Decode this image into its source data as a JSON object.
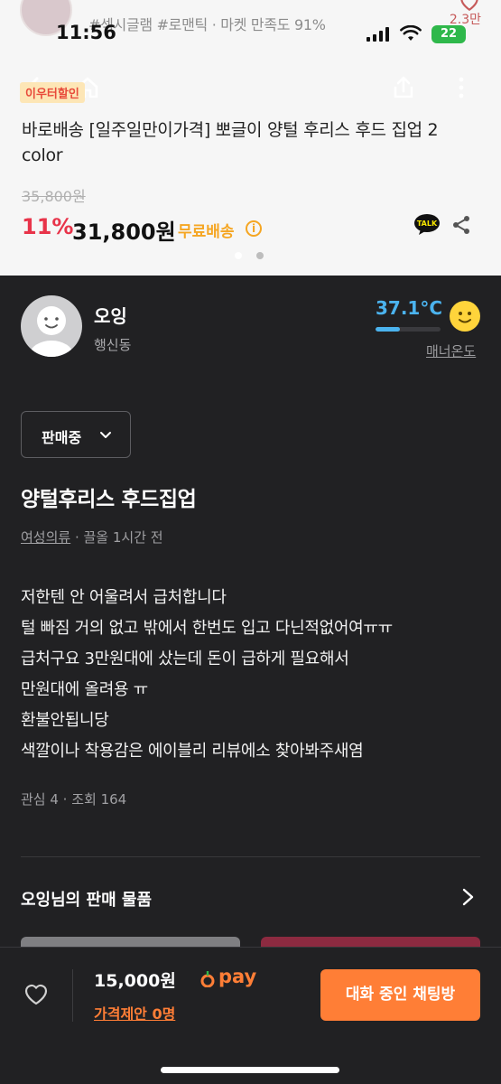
{
  "status_bar": {
    "time": "11:56",
    "battery": "22"
  },
  "background_listing": {
    "tags": "#섹시글램 #로맨틱 · 마켓 만족도 91%",
    "likes": "2.3만",
    "promo_badge": "이우터할인",
    "product_title": "바로배송 [일주일만이가격] 뽀글이 양털 후리스 후드 집업 2 color",
    "original_price": "35,800원",
    "discount": "11%",
    "price": "31,800원",
    "shipping": "무료배송",
    "info_icon": "i",
    "talk_label": "TALK"
  },
  "seller": {
    "name": "오잉",
    "location": "행신동",
    "temperature": "37.1°C",
    "temperature_level": 0.371,
    "manner_label": "매너온도"
  },
  "post": {
    "status": "판매중",
    "title": "양털후리스 후드집업",
    "category": "여성의류",
    "meta_rest": " · 끌올 1시간 전",
    "description": [
      "저한텐 안 어울려서 급처합니다",
      "털 빠짐 거의 없고 밖에서 한번도 입고 다닌적없어여ㅠㅠ",
      "급처구요 3만원대에 샀는데 돈이 급하게 필요해서",
      "만원대에 올려용 ㅠ",
      "환불안됩니당",
      "색깔이나 착용감은 에이블리 리뷰에소 찾아봐주새염"
    ],
    "stats": "관심 4 · 조회 164"
  },
  "seller_items": {
    "label": "오잉님의 판매 물품"
  },
  "bottom_bar": {
    "price": "15,000원",
    "pay_label": "pay",
    "offer_label": "가격제안 0명",
    "chat_button": "대화 중인 채팅방"
  },
  "colors": {
    "accent": "#ff7e36",
    "temperature": "#4bb3ee",
    "background": "#212123",
    "discount": "#e8344a"
  }
}
